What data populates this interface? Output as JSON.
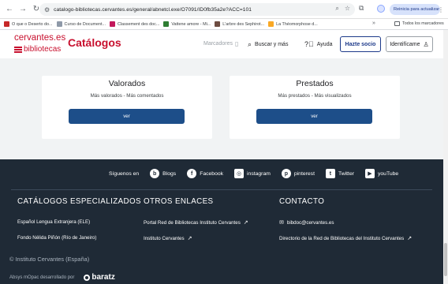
{
  "browser": {
    "url": "catalogo-bibliotecas.cervantes.es/general/abnetcl.exe/O7091/ID0fb35a2e?ACC=101",
    "update_label": "Reinicia para actualizar",
    "bookmarks": [
      {
        "label": "O que o Deserto do...",
        "color": "#c62828"
      },
      {
        "label": "Curso de Document...",
        "color": "#8e99a8"
      },
      {
        "label": "Classement des doc...",
        "color": "#c2185b"
      },
      {
        "label": "Vattene amore - Mi...",
        "color": "#2e7d32"
      },
      {
        "label": "L'arbre des Sephirot...",
        "color": "#6d4c41"
      },
      {
        "label": "La Théomorphose d...",
        "color": "#f9a825"
      }
    ],
    "all_bookmarks_label": "Todos los marcadores"
  },
  "header": {
    "logo_top": "cervantes.es",
    "logo_bottom": "bibliotecas",
    "section_title": "Catálogos",
    "marcadores": "Marcadores",
    "buscar": "Buscar y más",
    "ayuda": "Ayuda",
    "hazte_socio": "Hazte socio",
    "identificame": "Identifícame"
  },
  "cards": [
    {
      "title": "Valorados",
      "links": "Más valorados - Más comentados",
      "button": "ver"
    },
    {
      "title": "Prestados",
      "links": "Más prestados - Más visualizados",
      "button": "ver"
    }
  ],
  "footer": {
    "follow_label": "Síguenos en",
    "social": [
      {
        "label": "Blogs",
        "glyph": "b"
      },
      {
        "label": "Facebook",
        "glyph": "f"
      },
      {
        "label": "instagram",
        "glyph": "◎"
      },
      {
        "label": "pinterest",
        "glyph": "p"
      },
      {
        "label": "Twitter",
        "glyph": "t"
      },
      {
        "label": "youTube",
        "glyph": "▶"
      }
    ],
    "col1_heading": "CATÁLOGOS ESPECIALIZADOS",
    "col1_links": [
      "Español Lengua Extranjera (ELE)",
      "Fondo Nélida Piñón (Río de Janeiro)"
    ],
    "col2_heading": "OTROS ENLACES",
    "col2_links": [
      "Portal Red de Bibliotecas Instituto Cervantes",
      "Instituto Cervantes"
    ],
    "col3_heading": "CONTACTO",
    "col3_links": [
      "bibdoc@cervantes.es",
      "Directorio de la Red de Bibliotecas del Instituto Cervantes"
    ],
    "copyright": "© Instituto Cervantes (España)",
    "developed_by": "Absys mOpac desarrollado por",
    "developer": "baratz"
  }
}
